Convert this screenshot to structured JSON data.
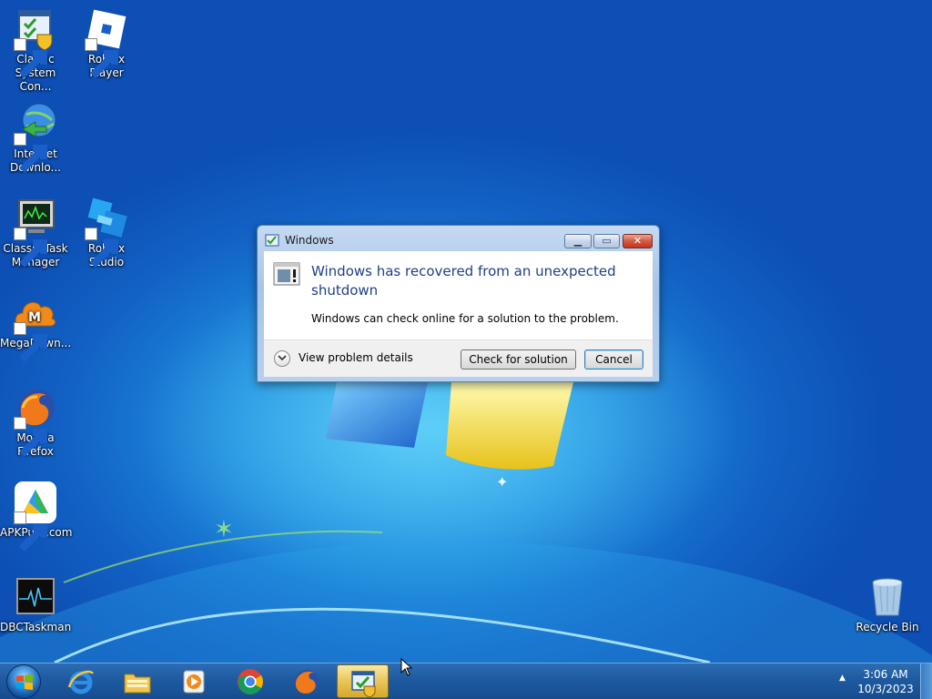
{
  "desktop": {
    "icons": [
      {
        "label": "Classic\nSystem Con...",
        "icon": "control-panel-icon"
      },
      {
        "label": "Roblox Player",
        "icon": "roblox-player-icon"
      },
      {
        "label": "Internet\nDownlo...",
        "icon": "internet-download-manager-icon"
      },
      {
        "label": "Classic Task\nManager",
        "icon": "task-manager-icon"
      },
      {
        "label": "Roblox Studio",
        "icon": "roblox-studio-icon"
      },
      {
        "label": "MegaDown...",
        "icon": "megadownloader-icon"
      },
      {
        "label": "Mozilla\nFirefox",
        "icon": "firefox-icon"
      },
      {
        "label": "APKPure.com",
        "icon": "apkpure-icon"
      },
      {
        "label": "DBCTaskman",
        "icon": "dbctaskman-icon"
      },
      {
        "label": "Recycle Bin",
        "icon": "recycle-bin-icon"
      }
    ]
  },
  "dialog": {
    "title": "Windows",
    "heading": "Windows has recovered from an unexpected shutdown",
    "message": "Windows can check online for a solution to the problem.",
    "details_label": "View problem details",
    "check_button": "Check for solution",
    "cancel_button": "Cancel"
  },
  "taskbar": {
    "apps": [
      "internet-explorer-icon",
      "windows-explorer-icon",
      "media-player-icon",
      "chrome-icon",
      "firefox-icon",
      "problem-reports-icon"
    ],
    "active_app": "problem-reports-icon",
    "clock_time": "3:06 AM",
    "clock_date": "10/3/2023"
  },
  "colors": {
    "heading": "#1f3f8a",
    "taskbar": "#1e5aa0",
    "close_button": "#d35a41"
  }
}
